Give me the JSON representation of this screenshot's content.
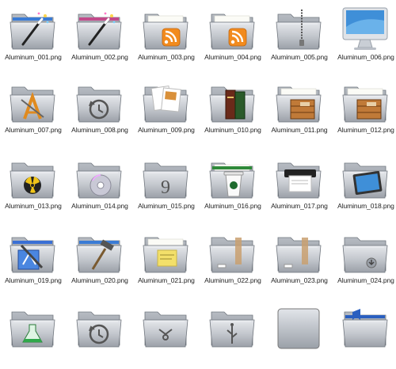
{
  "files": [
    {
      "label": "Aluminum_001.png",
      "icon": "magic-wand-icon",
      "accent": "#3a7bd5"
    },
    {
      "label": "Aluminum_002.png",
      "icon": "magic-wand-icon",
      "accent": "#c24a8a"
    },
    {
      "label": "Aluminum_003.png",
      "icon": "rss-icon",
      "accent": "#f28b1e"
    },
    {
      "label": "Aluminum_004.png",
      "icon": "rss-icon",
      "accent": "#f28b1e"
    },
    {
      "label": "Aluminum_005.png",
      "icon": "zipper-icon",
      "accent": "#777777"
    },
    {
      "label": "Aluminum_006.png",
      "icon": "imac-icon",
      "accent": "#3f8fd8"
    },
    {
      "label": "Aluminum_007.png",
      "icon": "applications-icon",
      "accent": "#e08a1e"
    },
    {
      "label": "Aluminum_008.png",
      "icon": "time-machine-icon",
      "accent": "#555555"
    },
    {
      "label": "Aluminum_009.png",
      "icon": "documents-icon",
      "accent": "#d9903a"
    },
    {
      "label": "Aluminum_010.png",
      "icon": "books-icon",
      "accent": "#6a2a1a"
    },
    {
      "label": "Aluminum_011.png",
      "icon": "crate-icon",
      "accent": "#b06a2a"
    },
    {
      "label": "Aluminum_012.png",
      "icon": "crate-icon",
      "accent": "#b06a2a"
    },
    {
      "label": "Aluminum_013.png",
      "icon": "burn-icon",
      "accent": "#f0c419"
    },
    {
      "label": "Aluminum_014.png",
      "icon": "cd-icon",
      "accent": "#c9c9d6"
    },
    {
      "label": "Aluminum_015.png",
      "icon": "spiral-icon",
      "accent": "#555555"
    },
    {
      "label": "Aluminum_016.png",
      "icon": "coffee-cup-icon",
      "accent": "#2f8a3a"
    },
    {
      "label": "Aluminum_017.png",
      "icon": "printer-icon",
      "accent": "#222222"
    },
    {
      "label": "Aluminum_018.png",
      "icon": "monitor-icon",
      "accent": "#3f8fd8"
    },
    {
      "label": "Aluminum_019.png",
      "icon": "xcode-icon",
      "accent": "#3a6fd5"
    },
    {
      "label": "Aluminum_020.png",
      "icon": "hammer-icon",
      "accent": "#555555"
    },
    {
      "label": "Aluminum_021.png",
      "icon": "sticky-note-icon",
      "accent": "#f3e06a"
    },
    {
      "label": "Aluminum_022.png",
      "icon": "tape-icon",
      "accent": "#c9a070"
    },
    {
      "label": "Aluminum_023.png",
      "icon": "tape-icon",
      "accent": "#c9a070"
    },
    {
      "label": "Aluminum_024.png",
      "icon": "download-icon",
      "accent": "#555555"
    },
    {
      "label": "",
      "icon": "flask-icon",
      "accent": "#2fa84a"
    },
    {
      "label": "",
      "icon": "time-machine-icon",
      "accent": "#555555"
    },
    {
      "label": "",
      "icon": "firewire-icon",
      "accent": "#555555"
    },
    {
      "label": "",
      "icon": "usb-icon",
      "accent": "#555555"
    },
    {
      "label": "",
      "icon": "plain-drive-icon",
      "accent": "#999999"
    },
    {
      "label": "",
      "icon": "bookmark-icon",
      "accent": "#2a5fc0"
    }
  ]
}
